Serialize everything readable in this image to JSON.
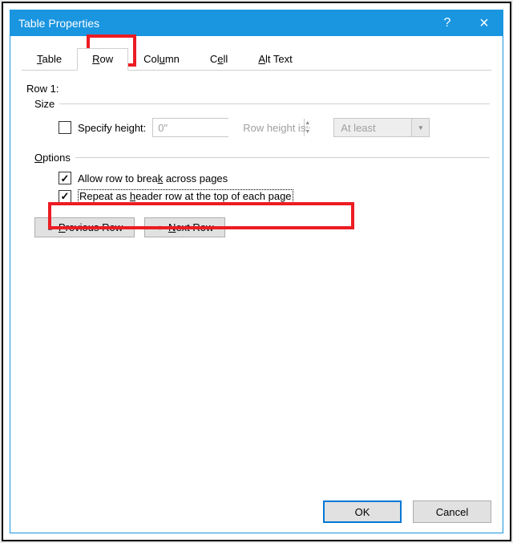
{
  "titlebar": {
    "title": "Table Properties",
    "help": "?",
    "close": "×"
  },
  "tabs": [
    {
      "label_pre": "",
      "u": "T",
      "label_post": "able"
    },
    {
      "label_pre": "",
      "u": "R",
      "label_post": "ow"
    },
    {
      "label_pre": "Col",
      "u": "u",
      "label_post": "mn"
    },
    {
      "label_pre": "C",
      "u": "e",
      "label_post": "ll"
    },
    {
      "label_pre": "",
      "u": "A",
      "label_post": "lt Text"
    }
  ],
  "row_header": "Row 1:",
  "size_label": "Size",
  "specify_height": {
    "pre": "",
    "u": "S",
    "post": "pecify height:"
  },
  "height_value": "0\"",
  "row_height_is": "Row height is:",
  "row_height_mode": "At least",
  "options_label_u": "O",
  "options_label_post": "ptions",
  "opt_break": {
    "pre": "Allow row to brea",
    "u": "k",
    "post": " across pages"
  },
  "opt_repeat": {
    "pre": "Repeat as ",
    "u": "h",
    "post": "eader row at the top of each page"
  },
  "prev_row": {
    "u": "P",
    "post": "revious Row"
  },
  "next_row": {
    "u": "N",
    "post": "ext Row"
  },
  "ok": "OK",
  "cancel": "Cancel"
}
